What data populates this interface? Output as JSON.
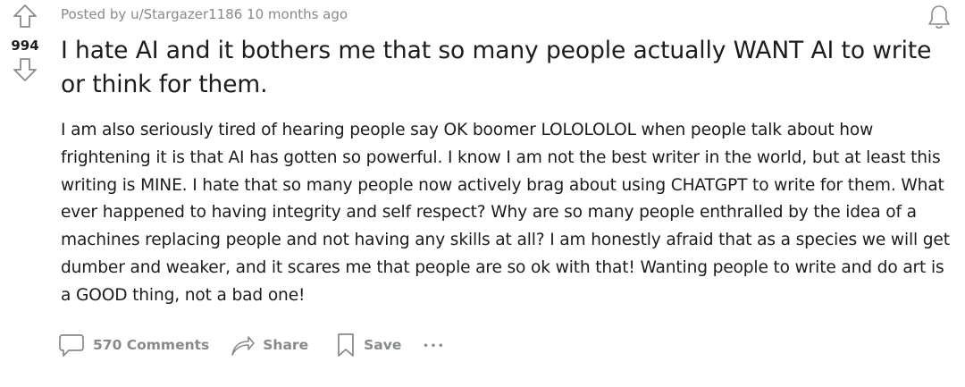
{
  "post": {
    "score": "994",
    "meta": "Posted by u/Stargazer1186 10 months ago",
    "title": "I hate AI and it bothers me that so many people actually WANT AI to write or think for them.",
    "body": "I am also seriously tired of hearing people say OK boomer LOLOLOLOL when people talk about how frightening it is that AI has gotten so powerful. I know I am not the best writer in the world, but at least this writing is MINE. I hate that so many people now actively brag about using CHATGPT to write for them. What ever happened to having integrity and self respect? Why are so many people enthralled by the idea of a machines replacing people and not having any skills at all? I am honestly afraid that as a species we will get dumber and weaker, and it scares me that people are so ok with that! Wanting people to write and do art is a GOOD thing, not a bad one!"
  },
  "actions": {
    "comments_label": "570 Comments",
    "share_label": "Share",
    "save_label": "Save",
    "more_label": "•••"
  },
  "icons": {
    "upvote": "arrow-up-icon",
    "downvote": "arrow-down-icon",
    "notify": "bell-icon",
    "comments": "comment-bubble-icon",
    "share": "share-arrow-icon",
    "save": "bookmark-icon",
    "more": "more-dots-icon"
  },
  "colors": {
    "text": "#1c1c1c",
    "muted": "#878a8c",
    "background": "#ffffff"
  }
}
